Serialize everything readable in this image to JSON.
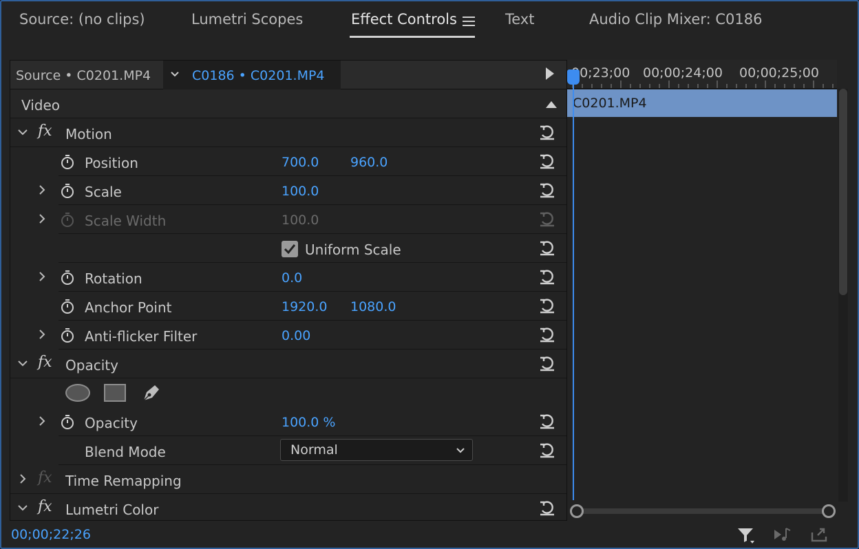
{
  "tabs": [
    {
      "label": "Source: (no clips)",
      "active": false
    },
    {
      "label": "Lumetri Scopes",
      "active": false
    },
    {
      "label": "Effect Controls",
      "active": true
    },
    {
      "label": "Text",
      "active": false
    },
    {
      "label": "Audio Clip Mixer: C0186",
      "active": false
    }
  ],
  "source_bar": {
    "source_label": "Source • C0201.MP4",
    "sequence_label": "C0186 • C0201.MP4"
  },
  "video_header": "Video",
  "motion": {
    "name": "Motion",
    "position": {
      "label": "Position",
      "x": "700.0",
      "y": "960.0"
    },
    "scale": {
      "label": "Scale",
      "value": "100.0"
    },
    "scale_width": {
      "label": "Scale Width",
      "value": "100.0"
    },
    "uniform_scale": {
      "label": "Uniform Scale",
      "checked": true
    },
    "rotation": {
      "label": "Rotation",
      "value": "0.0"
    },
    "anchor_point": {
      "label": "Anchor Point",
      "x": "1920.0",
      "y": "1080.0"
    },
    "anti_flicker": {
      "label": "Anti-flicker Filter",
      "value": "0.00"
    }
  },
  "opacity": {
    "name": "Opacity",
    "opacity": {
      "label": "Opacity",
      "value": "100.0 %"
    },
    "blend_mode": {
      "label": "Blend Mode",
      "value": "Normal"
    }
  },
  "time_remapping": {
    "name": "Time Remapping"
  },
  "lumetri": {
    "name": "Lumetri Color"
  },
  "timeline": {
    "ruler_labels": [
      "00;23;00",
      "00;00;24;00",
      "00;00;25;00"
    ],
    "clip_name": "C0201.MP4"
  },
  "footer": {
    "timecode": "00;00;22;26"
  },
  "colors": {
    "accent": "#4aa3ff",
    "clip": "#6e93c6",
    "playhead": "#3d8cf0",
    "frame_border": "#2f5f9a"
  },
  "icons": [
    "stopwatch-icon",
    "reset-icon",
    "filter-icon",
    "play-audio-icon",
    "export-icon",
    "pen-icon"
  ]
}
